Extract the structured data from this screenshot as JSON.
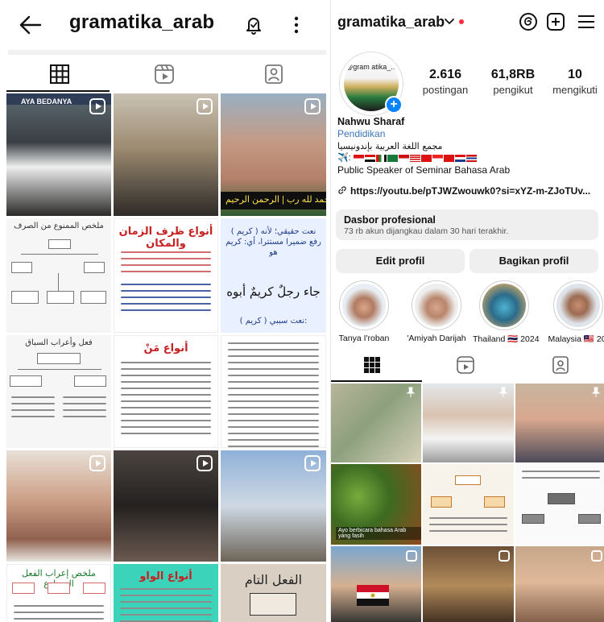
{
  "left": {
    "header": {
      "title": "gramatika_arab",
      "back_icon": "arrow-left-icon",
      "bell_icon": "notification-bell-icon",
      "more_icon": "more-vertical-icon"
    },
    "tabs": [
      {
        "name": "posts-grid",
        "icon": "grid-icon",
        "active": true
      },
      {
        "name": "reels",
        "icon": "reels-icon",
        "active": false
      },
      {
        "name": "tagged",
        "icon": "tagged-icon",
        "active": false
      }
    ],
    "grid": {
      "r1c1_strip": "AYA BEDANYA",
      "r1c3_caption": "الحمد لله رب | الرحمن الرحيم",
      "r2c1_heading": "ملخص الممنوع من الصرف",
      "r2c2_heading": "أنواع ظرف الزمان والمكان",
      "r2c3_text1": "( كريم ) نعت حقيقي؛ لأنه رفع ضميرا مستترا، أي: كريم هو",
      "r2c3_text2": "جاء رجلٌ كريمٌ أبوه",
      "r2c3_text3": "( كريم ) نعت سببي:",
      "r3c1_heading": "فعل وأعراب السباق",
      "r3c2_heading": "أنواع مَنْ",
      "r5c1_heading": "ملخص إعراب الفعل المضارع",
      "r5c2_heading": "أنواع الواو",
      "r5c3_heading": "الفعل التام"
    }
  },
  "right": {
    "header": {
      "username": "gramatika_arab",
      "chevron_icon": "chevron-down-icon",
      "threads_icon": "threads-icon",
      "add_icon": "add-square-icon",
      "menu_icon": "hamburger-menu-icon"
    },
    "avatar": {
      "text": "@gram atika_..."
    },
    "stats": {
      "posts_value": "2.616",
      "posts_label": "postingan",
      "followers_value": "61,8RB",
      "followers_label": "pengikut",
      "following_value": "10",
      "following_label": "mengikuti"
    },
    "bio": {
      "name": "Nahwu Sharaf",
      "category": "Pendidikan",
      "arabic": "مجمع اللغة العربية بإندونيسيا",
      "flags_prefix": "✈️:",
      "tagline": "Public Speaker of Seminar Bahasa Arab",
      "link": "https://youtu.be/pTJWZwouwk0?si=xYZ-m-ZJoTUv..."
    },
    "dashboard": {
      "title": "Dasbor profesional",
      "subtitle": "73 rb akun dijangkau dalam 30 hari terakhir."
    },
    "buttons": {
      "edit": "Edit profil",
      "share": "Bagikan profil"
    },
    "highlights": [
      {
        "label": "Tanya I'roban"
      },
      {
        "label": "'Amiyah Darijah"
      },
      {
        "label": "Thailand 🇹🇭 2024"
      },
      {
        "label": "Malaysia 🇲🇾 20."
      }
    ],
    "tabs": [
      {
        "name": "posts-grid",
        "icon": "grid-icon",
        "active": true
      },
      {
        "name": "reels",
        "icon": "reels-icon",
        "active": false
      },
      {
        "name": "tagged",
        "icon": "tagged-icon",
        "active": false
      }
    ],
    "grid": {
      "r2c1_caption": "Ayo berbicara bahasa Arab yang fasih"
    }
  }
}
